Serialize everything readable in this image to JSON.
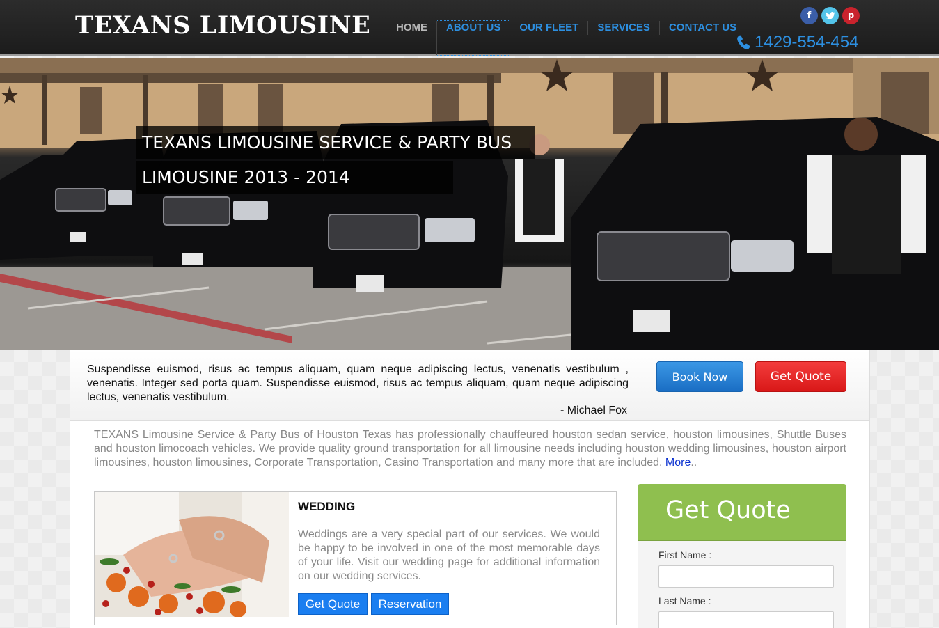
{
  "header": {
    "logo": "TEXANS LIMOUSINE",
    "nav": [
      "HOME",
      "ABOUT US",
      "OUR FLEET",
      "SERVICES",
      "CONTACT US"
    ],
    "active_nav": "ABOUT US",
    "social": {
      "facebook": "f",
      "twitter": "t",
      "pinterest": "p"
    },
    "phone": "1429-554-454",
    "icons": [
      "facebook-icon",
      "twitter-icon",
      "pinterest-icon",
      "phone-icon"
    ]
  },
  "hero": {
    "caption_line1": "TEXANS LIMOUSINE SERVICE & PARTY BUS",
    "caption_line2": "LIMOUSINE 2013 - 2014"
  },
  "testimonial": {
    "text": "Suspendisse euismod, risus ac tempus aliquam, quam neque adipiscing lectus, venenatis vestibulum , venenatis. Integer sed porta quam. Suspendisse euismod, risus ac tempus aliquam, quam neque adipiscing lectus, venenatis vestibulum.",
    "author": "- Michael Fox"
  },
  "actions": {
    "book_now": "Book Now",
    "get_quote": "Get Quote"
  },
  "intro": {
    "text": "TEXANS Limousine Service & Party Bus of Houston Texas has professionally chauffeured houston sedan service, houston limousines, Shuttle Buses and houston limocoach vehicles. We provide quality ground transportation for all limousine needs including houston wedding limousines, houston airport limousines, houston limousines, Corporate Transportation, Casino Transportation and many more that are included.",
    "more_link": "More",
    "more_suffix": ".."
  },
  "wedding": {
    "title": "WEDDING",
    "text": "Weddings are a very special part of our services. We would be happy to be involved in one of the most memorable days of your life. Visit our wedding page for additional information on our wedding services.",
    "quote_button": "Get Quote",
    "reservation_button": "Reservation"
  },
  "quote_form": {
    "title": "Get Quote",
    "first_name_label": "First Name :",
    "last_name_label": "Last Name :",
    "first_name_value": "",
    "last_name_value": ""
  },
  "colors": {
    "link_blue": "#2d8fe0",
    "book_blue": "#1a6ec4",
    "quote_red": "#d91818",
    "form_green": "#8fbf4f"
  }
}
